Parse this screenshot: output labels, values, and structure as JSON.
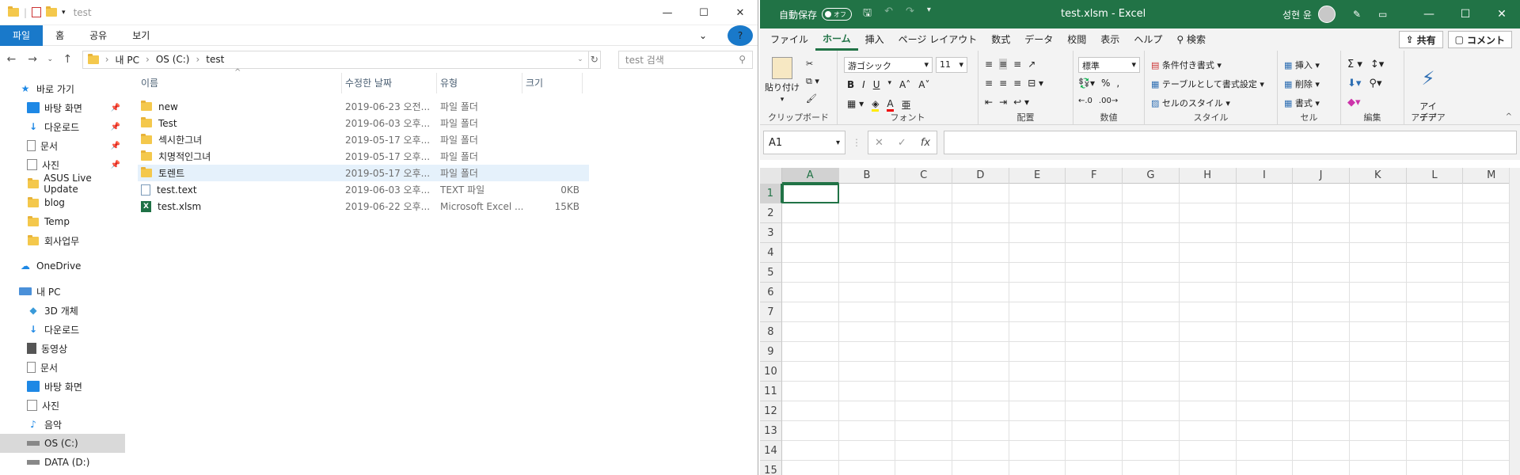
{
  "explorer": {
    "title": "test",
    "tabs": [
      "파일",
      "홈",
      "공유",
      "보기"
    ],
    "address": {
      "parts": [
        "내 PC",
        "OS (C:)",
        "test"
      ]
    },
    "search_placeholder": "test 검색",
    "columns": {
      "name": "이름",
      "date": "수정한 날짜",
      "type": "유형",
      "size": "크기"
    },
    "quick_access_label": "바로 가기",
    "nav": [
      {
        "label": "바탕 화면",
        "pinned": true
      },
      {
        "label": "다운로드",
        "pinned": true
      },
      {
        "label": "문서",
        "pinned": true
      },
      {
        "label": "사진",
        "pinned": true
      },
      {
        "label": "ASUS Live Update"
      },
      {
        "label": "blog"
      },
      {
        "label": "Temp"
      },
      {
        "label": "회사업무"
      }
    ],
    "onedrive_label": "OneDrive",
    "thispc_label": "내 PC",
    "pc_items": [
      "3D 개체",
      "다운로드",
      "동영상",
      "문서",
      "바탕 화면",
      "사진",
      "음악",
      "OS (C:)",
      "DATA (D:)"
    ],
    "files": [
      {
        "name": "new",
        "date": "2019-06-23 오전...",
        "type": "파일 폴더",
        "size": "",
        "kind": "folder"
      },
      {
        "name": "Test",
        "date": "2019-06-03 오후...",
        "type": "파일 폴더",
        "size": "",
        "kind": "folder"
      },
      {
        "name": "섹시한그녀",
        "date": "2019-05-17 오후...",
        "type": "파일 폴더",
        "size": "",
        "kind": "folder"
      },
      {
        "name": "치명적인그녀",
        "date": "2019-05-17 오후...",
        "type": "파일 폴더",
        "size": "",
        "kind": "folder"
      },
      {
        "name": "토렌트",
        "date": "2019-05-17 오후...",
        "type": "파일 폴더",
        "size": "",
        "kind": "folder"
      },
      {
        "name": "test.text",
        "date": "2019-06-03 오후...",
        "type": "TEXT 파일",
        "size": "0KB",
        "kind": "text"
      },
      {
        "name": "test.xlsm",
        "date": "2019-06-22 오후...",
        "type": "Microsoft Excel ...",
        "size": "15KB",
        "kind": "excel"
      }
    ]
  },
  "excel": {
    "autosave": "自動保存",
    "toggle": "オフ",
    "doc_title": "test.xlsm  -  Excel",
    "user": "성현 윤",
    "tabs": [
      "ファイル",
      "ホーム",
      "挿入",
      "ページ レイアウト",
      "数式",
      "データ",
      "校閲",
      "表示",
      "ヘルプ"
    ],
    "search_label": "検索",
    "share_label": "共有",
    "comment_label": "コメント",
    "ribbon": {
      "clipboard": {
        "label": "クリップボード",
        "paste": "貼り付け"
      },
      "font": {
        "label": "フォント",
        "name": "游ゴシック",
        "size": "11"
      },
      "alignment": {
        "label": "配置"
      },
      "number": {
        "label": "数値",
        "format": "標準"
      },
      "styles": {
        "label": "スタイル",
        "cond": "条件付き書式",
        "table": "テーブルとして書式設定",
        "cell": "セルのスタイル"
      },
      "cells": {
        "label": "セル",
        "insert": "挿入",
        "delete": "削除",
        "format": "書式"
      },
      "editing": {
        "label": "編集"
      },
      "ideas": {
        "label": "アイデア",
        "btn": "アイ\nデア"
      }
    },
    "namebox": "A1",
    "columns": [
      "A",
      "B",
      "C",
      "D",
      "E",
      "F",
      "G",
      "H",
      "I",
      "J",
      "K",
      "L",
      "M"
    ],
    "rows": [
      "1",
      "2",
      "3",
      "4",
      "5",
      "6",
      "7",
      "8",
      "9",
      "10",
      "11",
      "12",
      "13",
      "14",
      "15"
    ],
    "active_cell": "A1"
  }
}
